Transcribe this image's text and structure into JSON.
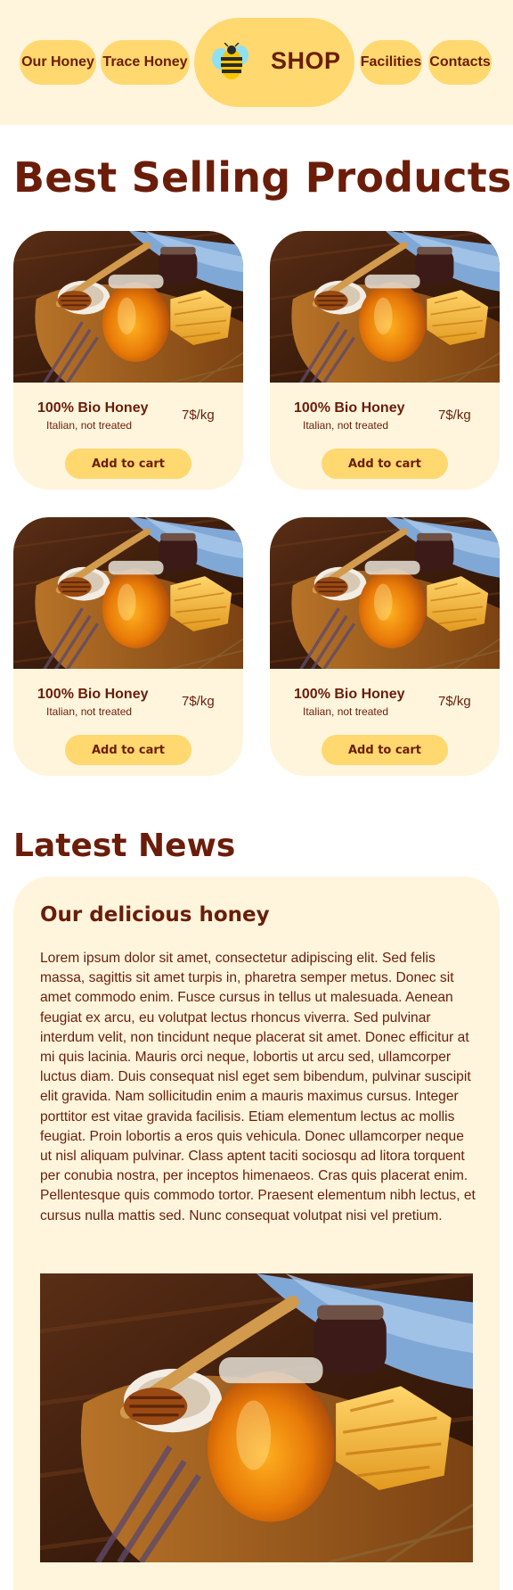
{
  "nav": {
    "left": [
      "Our Honey",
      "Trace Honey"
    ],
    "shop_label": "SHOP",
    "right": [
      "Facilities",
      "Contacts"
    ],
    "logo_icon": "bee-icon"
  },
  "best": {
    "title": "Best Selling Products",
    "products": [
      {
        "name": "100% Bio Honey",
        "subtitle": "Italian, not treated",
        "price": "7$/kg",
        "button": "Add to cart"
      },
      {
        "name": "100% Bio Honey",
        "subtitle": "Italian, not treated",
        "price": "7$/kg",
        "button": "Add to cart"
      },
      {
        "name": "100% Bio Honey",
        "subtitle": "Italian, not treated",
        "price": "7$/kg",
        "button": "Add to cart"
      },
      {
        "name": "100% Bio Honey",
        "subtitle": "Italian, not treated",
        "price": "7$/kg",
        "button": "Add to cart"
      }
    ]
  },
  "news": {
    "title": "Latest News",
    "article_title": "Our delicious honey",
    "article_body": "Lorem ipsum dolor sit amet, consectetur adipiscing elit. Sed felis massa, sagittis sit amet turpis in, pharetra semper metus. Donec sit amet commodo enim. Fusce cursus in tellus ut malesuada. Aenean feugiat ex arcu, eu volutpat lectus rhoncus viverra. Sed pulvinar interdum velit, non tincidunt neque placerat sit amet. Donec efficitur at mi quis lacinia. Mauris orci neque, lobortis ut arcu sed, ullamcorper luctus diam. Duis consequat nisl eget sem bibendum, pulvinar suscipit elit gravida. Nam sollicitudin enim a mauris maximus cursus. Integer porttitor est vitae gravida facilisis. Etiam elementum lectus ac mollis feugiat. Proin lobortis a eros quis vehicula. Donec ullamcorper neque ut nisl aliquam pulvinar. Class aptent taciti sociosqu ad litora torquent per conubia nostra, per inceptos himenaeos. Cras quis placerat enim. Pellentesque quis commodo tortor. Praesent elementum nibh lectus, et cursus nulla mattis sed. Nunc consequat volutpat nisi vel pretium."
  },
  "colors": {
    "brand_brown": "#6b1d09",
    "pill_yellow": "#ffd870",
    "cream": "#fff5dd"
  }
}
